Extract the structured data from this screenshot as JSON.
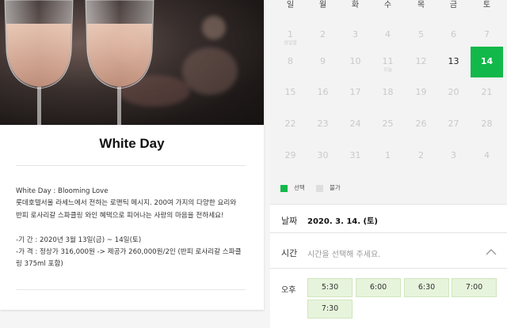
{
  "event": {
    "title": "White Day",
    "description_lines": [
      "White Day : Blooming Love",
      "롯데호텔서울 라세느에서 전하는 로맨틱 메시지. 200여 가지의 다양한 요리와",
      "반피 로사리갈 스파클링 와인 혜택으로 피어나는 사랑의 마음을 전하세요!",
      "",
      "-기    간 : 2020년 3월 13일(금) ~ 14일(토)",
      "-가    격 : 정상가 316,000원 -> 제공가 260,000원/2인 (반피 로사리갈 스파클",
      "링 375ml 포함)"
    ]
  },
  "calendar": {
    "weekdays": [
      "일",
      "월",
      "화",
      "수",
      "목",
      "금",
      "토"
    ],
    "weeks": [
      [
        {
          "d": "1",
          "note": "삼일절"
        },
        {
          "d": "2"
        },
        {
          "d": "3"
        },
        {
          "d": "4"
        },
        {
          "d": "5"
        },
        {
          "d": "6"
        },
        {
          "d": "7"
        }
      ],
      [
        {
          "d": "8"
        },
        {
          "d": "9"
        },
        {
          "d": "10"
        },
        {
          "d": "11",
          "note": "오늘"
        },
        {
          "d": "12"
        },
        {
          "d": "13",
          "state": "available"
        },
        {
          "d": "14",
          "state": "selected"
        }
      ],
      [
        {
          "d": "15"
        },
        {
          "d": "16"
        },
        {
          "d": "17"
        },
        {
          "d": "18"
        },
        {
          "d": "19"
        },
        {
          "d": "20"
        },
        {
          "d": "21"
        }
      ],
      [
        {
          "d": "22"
        },
        {
          "d": "23"
        },
        {
          "d": "24"
        },
        {
          "d": "25"
        },
        {
          "d": "26"
        },
        {
          "d": "27"
        },
        {
          "d": "28"
        }
      ],
      [
        {
          "d": "29"
        },
        {
          "d": "30"
        },
        {
          "d": "31"
        },
        {
          "d": "1"
        },
        {
          "d": "2"
        },
        {
          "d": "3"
        },
        {
          "d": "4"
        }
      ]
    ],
    "legend": {
      "selected": "선택",
      "unavailable": "불가"
    },
    "colors": {
      "selected": "#12b84a",
      "unavailable": "#dedede"
    }
  },
  "booking": {
    "date_label": "날짜",
    "date_value": "2020. 3. 14. (토)",
    "time_label": "시간",
    "time_placeholder": "시간을 선택해 주세요.",
    "period_label": "오후",
    "slots": [
      "5:30",
      "6:00",
      "6:30",
      "7:00",
      "7:30"
    ]
  }
}
